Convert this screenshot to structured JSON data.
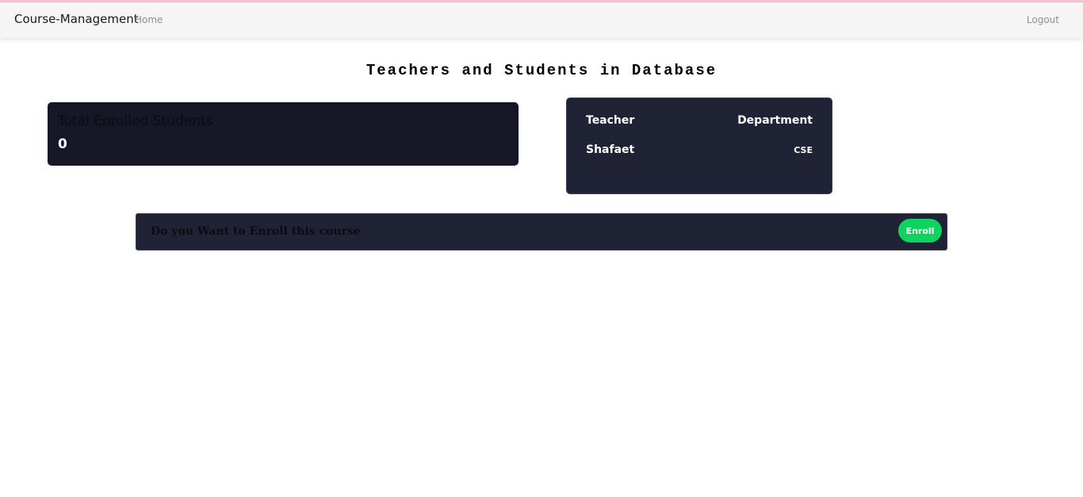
{
  "navbar": {
    "brand": "Course-Management",
    "home_label": "Home",
    "logout_label": "Logout"
  },
  "main": {
    "title": "Teachers and Students in Database",
    "enrolled_card": {
      "label": "Total Enrolled Students",
      "value": "0"
    },
    "teacher_table": {
      "headers": [
        "Teacher",
        "Department"
      ],
      "rows": [
        {
          "teacher": "Shafaet",
          "department": "CSE"
        }
      ]
    },
    "enroll_prompt": {
      "text": "Do you Want to Enroll this course",
      "button_label": "Enroll"
    }
  },
  "colors": {
    "accent_green": "#10d35f",
    "card_dark": "#1f2335",
    "card_darker": "#151726"
  }
}
